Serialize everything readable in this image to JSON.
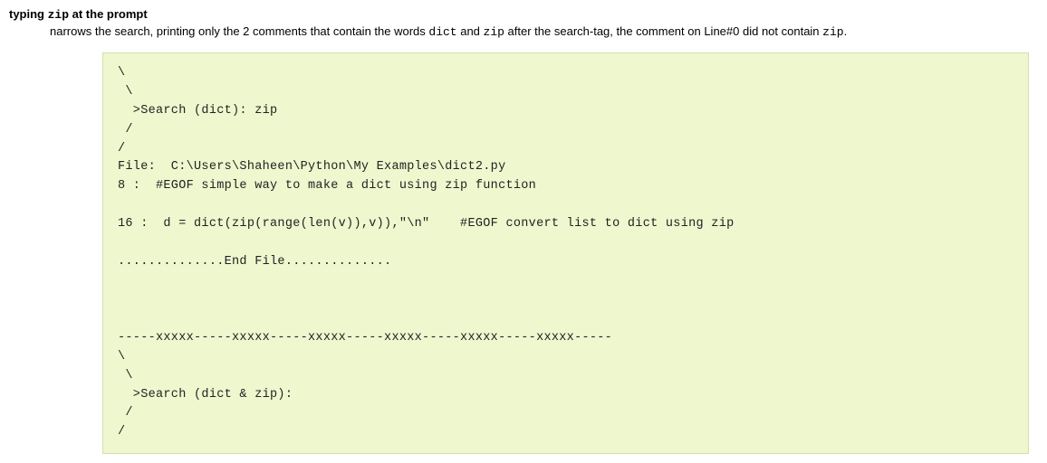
{
  "heading": {
    "pre": "typing ",
    "code": "zip",
    "post": " at the prompt"
  },
  "desc": {
    "p1": "narrows the search, printing only the 2 comments that contain the words ",
    "c1": "dict",
    "p2": " and ",
    "c2": "zip",
    "p3": " after the search-tag, the comment on Line#0 did not contain ",
    "c3": "zip",
    "p4": "."
  },
  "code": "\\\n \\\n  >Search (dict): zip\n /\n/\nFile:  C:\\Users\\Shaheen\\Python\\My Examples\\dict2.py\n8 :  #EGOF simple way to make a dict using zip function\n\n16 :  d = dict(zip(range(len(v)),v)),\"\\n\"    #EGOF convert list to dict using zip\n\n..............End File..............\n\n\n\n-----xxxxx-----xxxxx-----xxxxx-----xxxxx-----xxxxx-----xxxxx-----\n\\\n \\\n  >Search (dict & zip):\n /\n/"
}
